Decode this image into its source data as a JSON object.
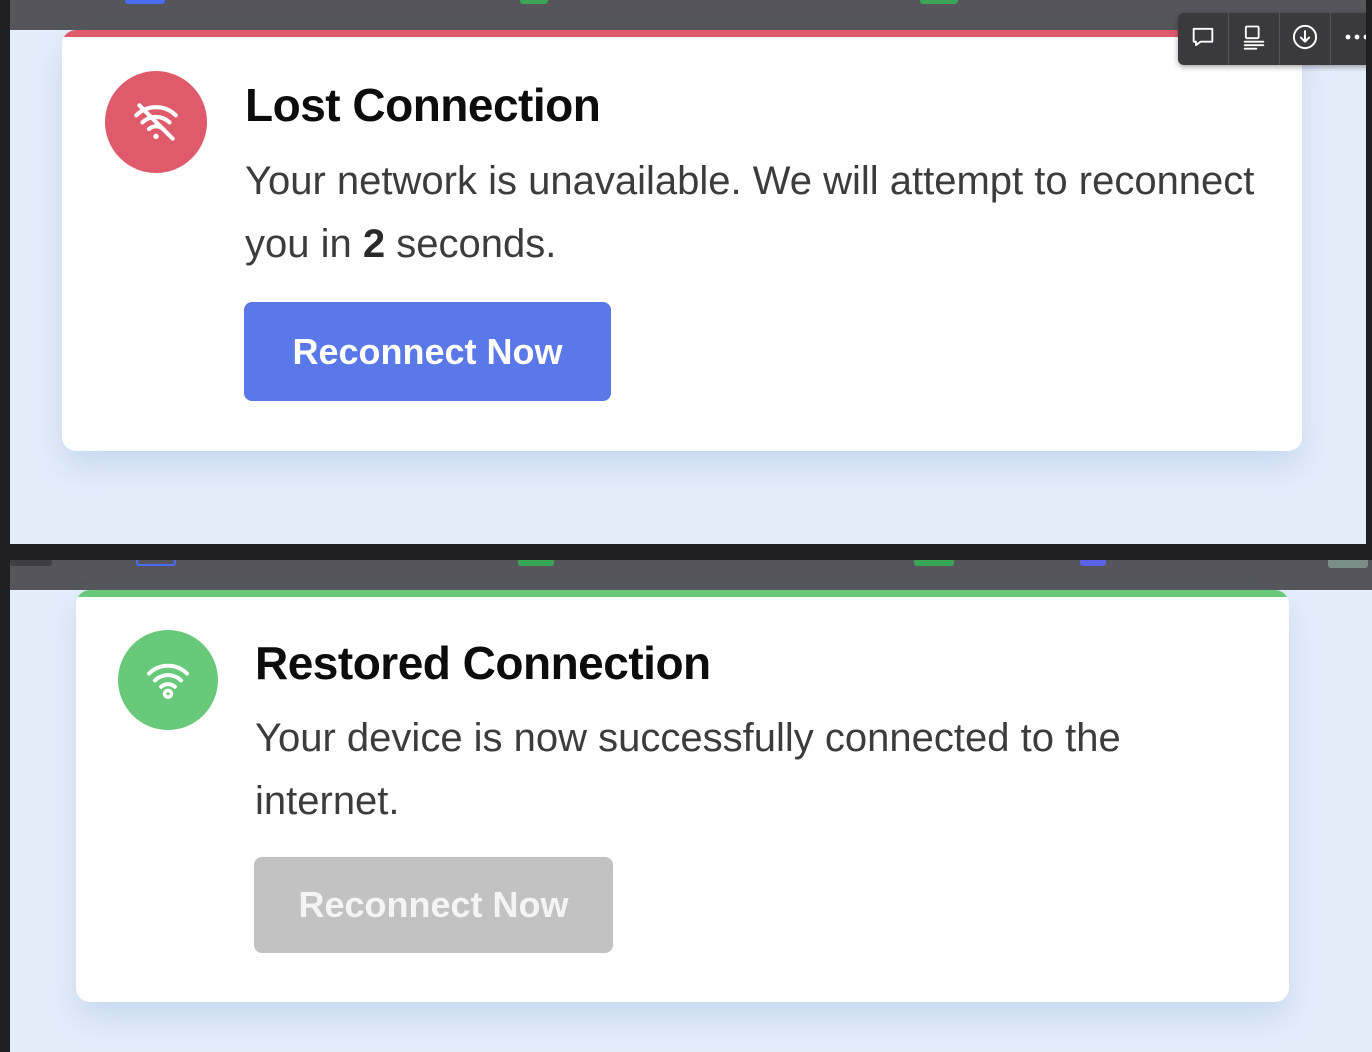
{
  "colors": {
    "page_background": "#e4eefb",
    "tabstrip": "#55555b",
    "error_accent": "#df5b6b",
    "success_accent": "#69c97a",
    "primary_button": "#5a78e8",
    "disabled_button": "#c2c2c2"
  },
  "toolbar": {
    "buttons": [
      {
        "icon": "comment-icon"
      },
      {
        "icon": "layout-icon"
      },
      {
        "icon": "download-icon"
      },
      {
        "icon": "more-icon"
      }
    ]
  },
  "lost_card": {
    "icon": "wifi-off-icon",
    "title": "Lost Connection",
    "message_before": "Your network is unavailable. We will attempt to reconnect you in ",
    "countdown": "2",
    "message_after": " seconds.",
    "button_label": "Reconnect Now",
    "button_state": "enabled"
  },
  "restored_card": {
    "icon": "wifi-icon",
    "title": "Restored Connection",
    "message": "Your device is now successfully connected to the internet.",
    "button_label": "Reconnect Now",
    "button_state": "disabled"
  }
}
